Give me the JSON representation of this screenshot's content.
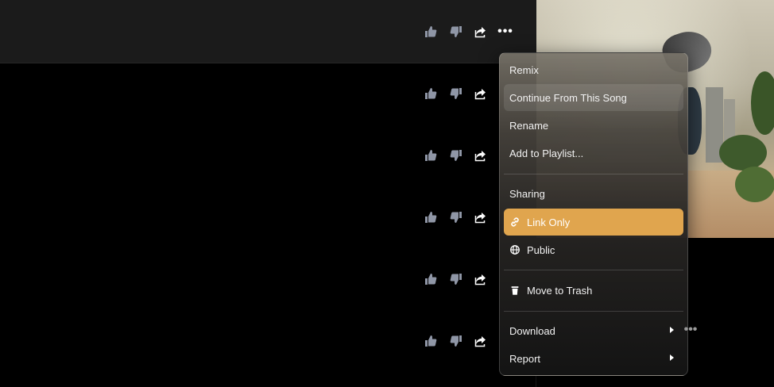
{
  "song_actions": {
    "like_icon": "thumbs-up-icon",
    "dislike_icon": "thumbs-down-icon",
    "share_icon": "share-icon",
    "more_label": "•••"
  },
  "cover": {
    "icon": "album-cover-image"
  },
  "menu": {
    "remix": "Remix",
    "continue": "Continue From This Song",
    "rename": "Rename",
    "add_playlist": "Add to Playlist...",
    "sharing_heading": "Sharing",
    "link_only": "Link Only",
    "public": "Public",
    "trash": "Move to Trash",
    "download": "Download",
    "report": "Report"
  },
  "colors": {
    "accent": "#e0a54e",
    "row_bg": "#1b1b1b",
    "icon_muted": "#8f96a6"
  }
}
